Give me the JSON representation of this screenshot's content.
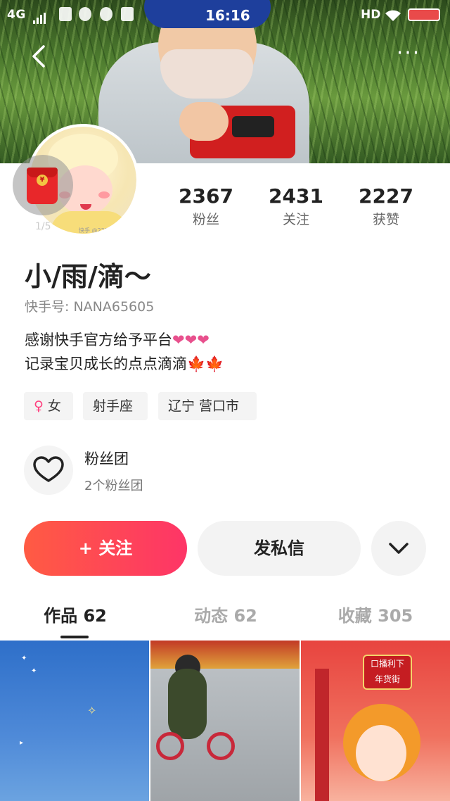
{
  "status_bar": {
    "network": "4G",
    "time": "16:16",
    "hd_label": "HD"
  },
  "header": {
    "back_icon": "chevron-left-icon",
    "more_icon": "ellipsis-icon",
    "more_label": "···"
  },
  "avatar": {
    "pager": "1/5",
    "watermark": "快手 @2324890..."
  },
  "stats": [
    {
      "value": "2367",
      "label": "粉丝"
    },
    {
      "value": "2431",
      "label": "关注"
    },
    {
      "value": "2227",
      "label": "获赞"
    }
  ],
  "profile": {
    "name": "小/雨/滴～",
    "kuaishou_id": "快手号: NANA65605",
    "bio_line1": "感谢快手官方给予平台",
    "bio_line1_emoji": "❤❤❤",
    "bio_line2": "记录宝贝成长的点点滴滴",
    "bio_line2_emoji": "🍁🍁"
  },
  "tags": {
    "gender_symbol": "♀",
    "gender": "女",
    "zodiac": "射手座",
    "location": "辽宁 营口市"
  },
  "fan_group": {
    "title": "粉丝团",
    "subtitle": "2个粉丝团"
  },
  "actions": {
    "follow": "+ 关注",
    "message": "发私信"
  },
  "tabs": [
    {
      "label": "作品 62",
      "active": true
    },
    {
      "label": "动态 62",
      "active": false
    },
    {
      "label": "收藏 305",
      "active": false
    }
  ],
  "thumbnails": {
    "third_sign_line1": "口播利下",
    "third_sign_line2": "年货街"
  },
  "colors": {
    "follow_gradient_start": "#ff5b43",
    "follow_gradient_end": "#fe3567",
    "heart": "#e8508d"
  }
}
